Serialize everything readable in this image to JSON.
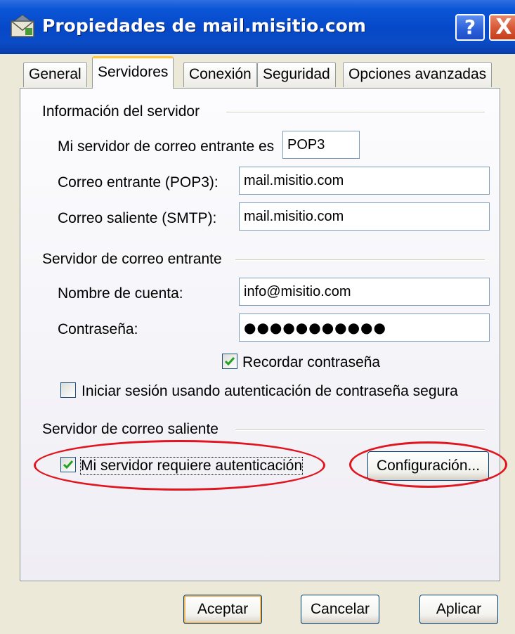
{
  "window": {
    "title": "Propiedades de mail.misitio.com",
    "help_label": "?",
    "close_label": "X"
  },
  "tabs": [
    {
      "label": "General",
      "active": false
    },
    {
      "label": "Servidores",
      "active": true
    },
    {
      "label": "Conexión",
      "active": false
    },
    {
      "label": "Seguridad",
      "active": false
    },
    {
      "label": "Opciones avanzadas",
      "active": false
    }
  ],
  "server_info": {
    "section_label": "Información del servidor",
    "incoming_type_label": "Mi servidor de correo entrante es",
    "incoming_type_value": "POP3",
    "incoming_label": "Correo entrante (POP3):",
    "incoming_value": "mail.misitio.com",
    "outgoing_label": "Correo saliente (SMTP):",
    "outgoing_value": "mail.misitio.com"
  },
  "incoming_server": {
    "section_label": "Servidor de correo entrante",
    "account_label": "Nombre de cuenta:",
    "account_value": "info@misitio.com",
    "password_label": "Contraseña:",
    "password_value": "●●●●●●●●●●●",
    "remember_label": "Recordar contraseña",
    "remember_checked": true,
    "spa_label": "Iniciar sesión usando autenticación de contraseña segura",
    "spa_checked": false
  },
  "outgoing_server": {
    "section_label": "Servidor de correo saliente",
    "auth_label": "Mi servidor requiere autenticación",
    "auth_checked": true,
    "settings_button": "Configuración..."
  },
  "buttons": {
    "ok": "Aceptar",
    "cancel": "Cancelar",
    "apply": "Aplicar"
  },
  "colors": {
    "title_bar": "#0a55d6",
    "highlight_ring": "#e1151f",
    "tab_accent": "#ffc83c"
  },
  "icons": {
    "window_icon": "mail-envelope-icon",
    "help": "help-icon",
    "close": "close-icon"
  }
}
